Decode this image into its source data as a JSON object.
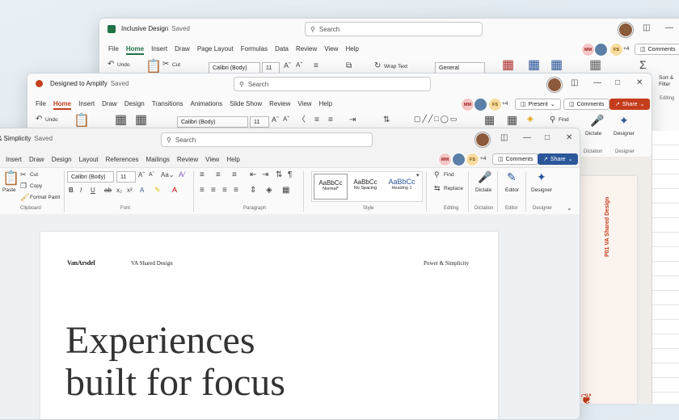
{
  "excel": {
    "title": "Inclusive Design",
    "saved": "Saved",
    "search": "Search",
    "tabs": [
      "File",
      "Home",
      "Insert",
      "Draw",
      "Page Layout",
      "Formulas",
      "Data",
      "Review",
      "View",
      "Help"
    ],
    "collab_count": "+4",
    "comments": "Comments",
    "undo": "Undo",
    "cut": "Cut",
    "font": "Calibri (Body)",
    "size": "11",
    "wrap": "Wrap Text",
    "number_format": "General",
    "sort_filter": "Sort &\nFilter",
    "editing": "Editing",
    "accent": "#217346"
  },
  "ppt": {
    "title": "Designed to Amplify",
    "saved": "Saved",
    "search": "Search",
    "tabs": [
      "File",
      "Home",
      "Insert",
      "Draw",
      "Design",
      "Transitions",
      "Animations",
      "Slide Show",
      "Review",
      "View",
      "Help"
    ],
    "collab_count": "+4",
    "present": "Present",
    "comments": "Comments",
    "share": "Share",
    "undo": "Undo",
    "font": "Calibri (Body)",
    "size": "11",
    "find": "Find",
    "dictate": "Dictate",
    "designer": "Designer",
    "group_dictation": "Dictation",
    "group_designer": "Designer",
    "accent": "#c43e1c",
    "slide_label": "P01  VA Shared Design"
  },
  "word": {
    "title": "Power & Simplicity",
    "title_visible": "& Simplicity",
    "saved": "Saved",
    "search": "Search",
    "tabs": [
      "Insert",
      "Draw",
      "Design",
      "Layout",
      "References",
      "Mailings",
      "Review",
      "View",
      "Help"
    ],
    "collab_count": "+4",
    "comments": "Comments",
    "share": "Share",
    "paste": "Paste",
    "cut": "Cut",
    "copy": "Copy",
    "format_painter": "Format Paint",
    "font": "Calibri (Body)",
    "size": "11",
    "styles": [
      {
        "preview": "AaBbCc",
        "name": "Normal*"
      },
      {
        "preview": "AaBbCc",
        "name": "No Spacing"
      },
      {
        "preview": "AaBbCc",
        "name": "Heading 1"
      }
    ],
    "find": "Find",
    "replace": "Replace",
    "dictate": "Dictate",
    "editor": "Editor",
    "designer": "Designer",
    "groups": [
      "Clipboard",
      "Font",
      "Paragraph",
      "Style",
      "Editing",
      "Dictation",
      "Editor",
      "Designer"
    ],
    "accent": "#2b579a",
    "doc": {
      "logo": "VanArsdel",
      "header_center": "VA Shared Design",
      "header_right": "Power & Simplicity",
      "heading_line1": "Experiences",
      "heading_line2": "built for focus"
    }
  },
  "avatars": {
    "mm": "MM",
    "fs": "FS"
  }
}
